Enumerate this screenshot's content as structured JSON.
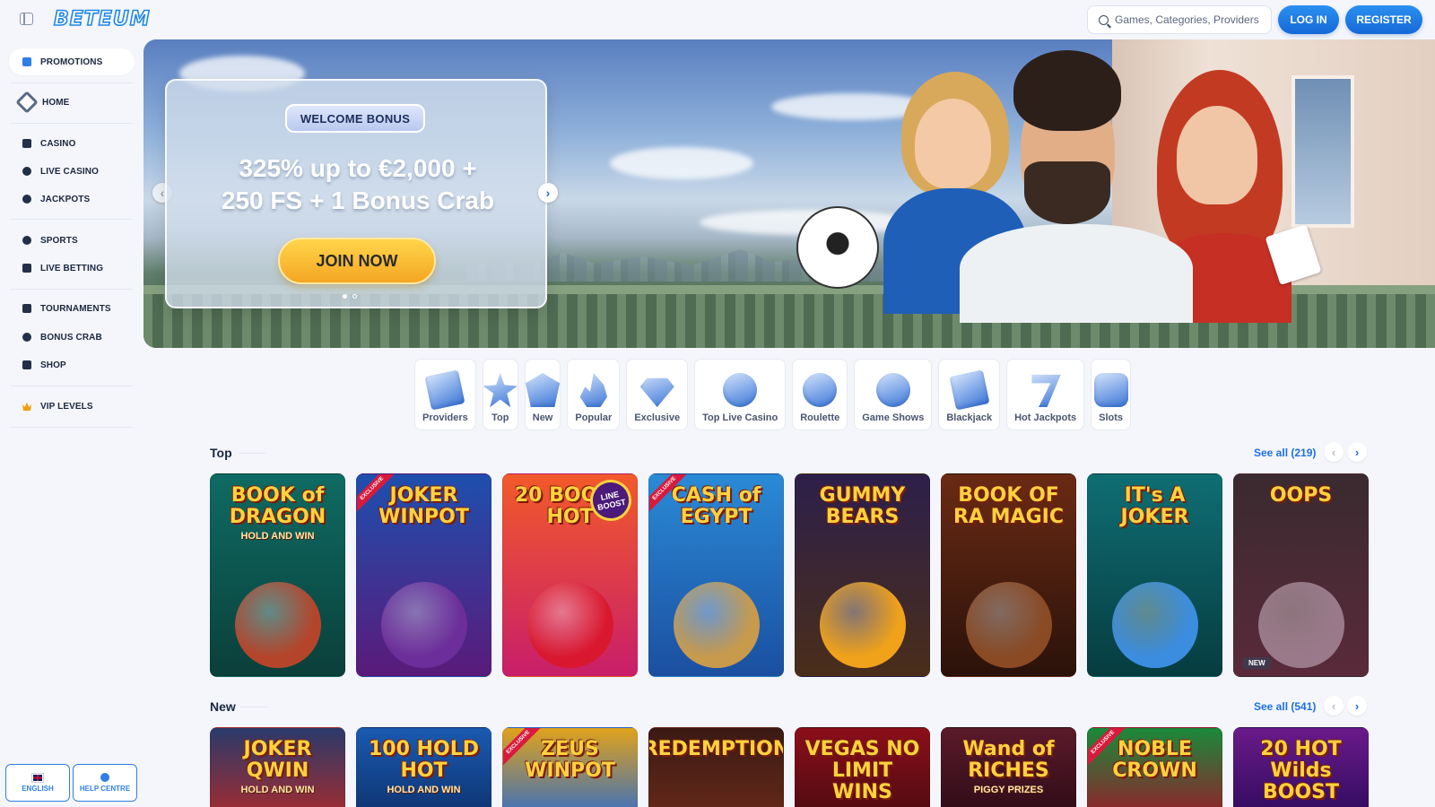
{
  "header": {
    "logo": "BETEUM",
    "search_placeholder": "Games, Categories, Providers",
    "login_label": "LOG IN",
    "register_label": "REGISTER"
  },
  "sidebar": {
    "promotions": "PROMOTIONS",
    "items": [
      {
        "label": "HOME",
        "icon": "home-icon"
      },
      {
        "label": "CASINO",
        "icon": "seven-icon"
      },
      {
        "label": "LIVE CASINO",
        "icon": "live-dot-icon"
      },
      {
        "label": "JACKPOTS",
        "icon": "clover-icon"
      },
      {
        "label": "SPORTS",
        "icon": "soccer-ball-icon"
      },
      {
        "label": "LIVE BETTING",
        "icon": "live-tv-icon"
      },
      {
        "label": "TOURNAMENTS",
        "icon": "trophy-icon"
      },
      {
        "label": "BONUS CRAB",
        "icon": "crab-icon"
      },
      {
        "label": "SHOP",
        "icon": "bag-icon"
      },
      {
        "label": "VIP LEVELS",
        "icon": "crown-icon"
      }
    ],
    "language_label": "ENGLISH",
    "help_label": "HELP CENTRE"
  },
  "hero": {
    "badge": "WELCOME BONUS",
    "title_line1": "325% up to €2,000 +",
    "title_line2": "250 FS + 1 Bonus Crab",
    "cta": "JOIN NOW",
    "slide_count": 2,
    "active_slide": 1
  },
  "categories": [
    {
      "label": "Providers",
      "icon": "book-icon"
    },
    {
      "label": "Top",
      "icon": "star-icon"
    },
    {
      "label": "New",
      "icon": "new-badge-icon"
    },
    {
      "label": "Popular",
      "icon": "flame-icon"
    },
    {
      "label": "Exclusive",
      "icon": "diamond-icon"
    },
    {
      "label": "Top Live Casino",
      "icon": "medal-icon"
    },
    {
      "label": "Roulette",
      "icon": "roulette-icon"
    },
    {
      "label": "Game Shows",
      "icon": "wheel-icon"
    },
    {
      "label": "Blackjack",
      "icon": "cards-icon"
    },
    {
      "label": "Hot Jackpots",
      "icon": "seven-icon"
    },
    {
      "label": "Slots",
      "icon": "slot-machine-icon"
    }
  ],
  "sections": {
    "top": {
      "title": "Top",
      "see_all": "See all (219)",
      "games": [
        {
          "title": "BOOK of DRAGON",
          "sub": "HOLD AND WIN",
          "bg": "#0e6b63",
          "bg2": "#0b3f3a",
          "art": "#b4452b",
          "exclusive": false,
          "new": false,
          "badge": ""
        },
        {
          "title": "JOKER WINPOT",
          "sub": "",
          "bg": "#1e4fae",
          "bg2": "#5a1a7a",
          "art": "#6b2e9a",
          "exclusive": true,
          "new": false,
          "badge": ""
        },
        {
          "title": "20 BOOST HOT",
          "sub": "",
          "bg": "#f25a2a",
          "bg2": "#c81e6a",
          "art": "#d9182f",
          "exclusive": false,
          "new": false,
          "badge": "LINE BOOST"
        },
        {
          "title": "CASH of EGYPT",
          "sub": "",
          "bg": "#2a8ad6",
          "bg2": "#1b4fa0",
          "art": "#c89a4b",
          "exclusive": true,
          "new": false,
          "badge": ""
        },
        {
          "title": "GUMMY BEARS",
          "sub": "",
          "bg": "#2d1f4a",
          "bg2": "#4a2e1a",
          "art": "#f0a21a",
          "exclusive": false,
          "new": false,
          "badge": ""
        },
        {
          "title": "BOOK OF RA MAGIC",
          "sub": "",
          "bg": "#6a2a14",
          "bg2": "#2a120a",
          "art": "#8a4a24",
          "exclusive": false,
          "new": false,
          "badge": ""
        },
        {
          "title": "IT's A JOKER",
          "sub": "",
          "bg": "#0f6e73",
          "bg2": "#063c40",
          "art": "#3b8de0",
          "exclusive": false,
          "new": false,
          "badge": ""
        },
        {
          "title": "OOPS",
          "sub": "",
          "bg": "#3a2a30",
          "bg2": "#5a2a3a",
          "art": "#9a7a8a",
          "exclusive": false,
          "new": true,
          "badge": ""
        }
      ]
    },
    "new": {
      "title": "New",
      "see_all": "See all (541)",
      "games": [
        {
          "title": "JOKER QWIN",
          "sub": "HOLD AND WIN",
          "bg": "#2a3a6a",
          "bg2": "#b02a2a",
          "exclusive": false
        },
        {
          "title": "100 HOLD HOT",
          "sub": "HOLD AND WIN",
          "bg": "#1a5ab0",
          "bg2": "#0d2f6a",
          "exclusive": false
        },
        {
          "title": "ZEUS WINPOT",
          "sub": "",
          "bg": "#e0a21a",
          "bg2": "#2a6ad0",
          "exclusive": true
        },
        {
          "title": "REDEMPTION",
          "sub": "",
          "bg": "#3a1a14",
          "bg2": "#6a2a1a",
          "exclusive": false
        },
        {
          "title": "VEGAS NO LIMIT WINS",
          "sub": "",
          "bg": "#8a0f1a",
          "bg2": "#4a0a10",
          "exclusive": false
        },
        {
          "title": "Wand of RICHES",
          "sub": "PIGGY PRIZES",
          "bg": "#5a1a2a",
          "bg2": "#2a0a14",
          "exclusive": false
        },
        {
          "title": "NOBLE CROWN",
          "sub": "",
          "bg": "#1a8a3a",
          "bg2": "#a0142a",
          "exclusive": true
        },
        {
          "title": "20 HOT Wilds BOOST",
          "sub": "",
          "bg": "#6a1a8a",
          "bg2": "#2a0a5a",
          "exclusive": false
        }
      ]
    }
  },
  "labels": {
    "exclusive": "EXCLUSIVE",
    "new": "NEW"
  },
  "colors": {
    "accent": "#1f6fe0",
    "cta": "#f5a623",
    "background": "#f4f6fb"
  }
}
